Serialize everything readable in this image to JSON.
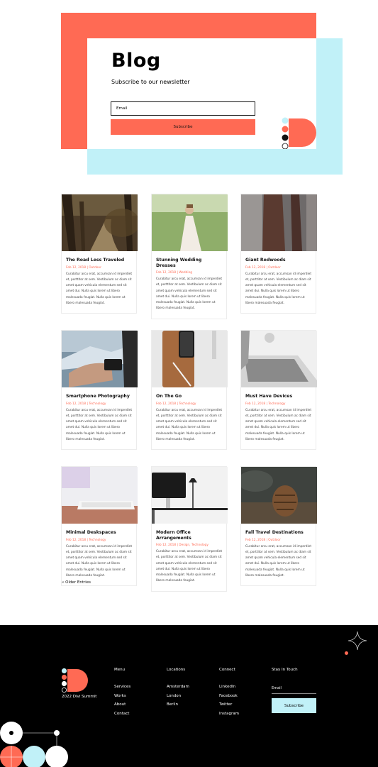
{
  "colors": {
    "coral": "#ff6a54",
    "cyan": "#c1f1f8",
    "black": "#000000"
  },
  "hero": {
    "title": "Blog",
    "subtitle": "Subscribe to our newsletter",
    "email_placeholder": "Email",
    "subscribe_label": "Subscribe"
  },
  "posts": [
    {
      "title": "The Road Less Traveled",
      "meta": "Feb 12, 2018 | Outdoor",
      "excerpt": "Curabitur arcu erat, accumsan id imperdiet et, porttitor at sem. Vestibulum ac diam sit amet quam vehicula elementum sed sit amet dui. Nulla quis lorem ut libero malesuada feugiat. Nulla quis lorem ut libero malesuada feugiat."
    },
    {
      "title": "Stunning Wedding Dresses",
      "meta": "Feb 12, 2018 | Wedding",
      "excerpt": "Curabitur arcu erat, accumsan id imperdiet et, porttitor at sem. Vestibulum ac diam sit amet quam vehicula elementum sed sit amet dui. Nulla quis lorem ut libero malesuada feugiat. Nulla quis lorem ut libero malesuada feugiat."
    },
    {
      "title": "Giant Redwoods",
      "meta": "Feb 12, 2018 | Outdoor",
      "excerpt": "Curabitur arcu erat, accumsan id imperdiet et, porttitor at sem. Vestibulum ac diam sit amet quam vehicula elementum sed sit amet dui. Nulla quis lorem ut libero malesuada feugiat. Nulla quis lorem ut libero malesuada feugiat."
    },
    {
      "title": "Smartphone Photography",
      "meta": "Feb 12, 2018 | Technology",
      "excerpt": "Curabitur arcu erat, accumsan id imperdiet et, porttitor at sem. Vestibulum ac diam sit amet quam vehicula elementum sed sit amet dui. Nulla quis lorem ut libero malesuada feugiat. Nulla quis lorem ut libero malesuada feugiat."
    },
    {
      "title": "On The Go",
      "meta": "Feb 12, 2018 | Technology",
      "excerpt": "Curabitur arcu erat, accumsan id imperdiet et, porttitor at sem. Vestibulum ac diam sit amet quam vehicula elementum sed sit amet dui. Nulla quis lorem ut libero malesuada feugiat. Nulla quis lorem ut libero malesuada feugiat."
    },
    {
      "title": "Must Have Devices",
      "meta": "Feb 12, 2018 | Technology",
      "excerpt": "Curabitur arcu erat, accumsan id imperdiet et, porttitor at sem. Vestibulum ac diam sit amet quam vehicula elementum sed sit amet dui. Nulla quis lorem ut libero malesuada feugiat. Nulla quis lorem ut libero malesuada feugiat."
    },
    {
      "title": "Minimal Deskspaces",
      "meta": "Feb 12, 2018 | Technology",
      "excerpt": "Curabitur arcu erat, accumsan id imperdiet et, porttitor at sem. Vestibulum ac diam sit amet quam vehicula elementum sed sit amet dui. Nulla quis lorem ut libero malesuada feugiat. Nulla quis lorem ut libero malesuada feugiat."
    },
    {
      "title": "Modern Office Arrangements",
      "meta": "Feb 12, 2018 | Design, Technology",
      "excerpt": "Curabitur arcu erat, accumsan id imperdiet et, porttitor at sem. Vestibulum ac diam sit amet quam vehicula elementum sed sit amet dui. Nulla quis lorem ut libero malesuada feugiat. Nulla quis lorem ut libero malesuada feugiat."
    },
    {
      "title": "Fall Travel Destinations",
      "meta": "Feb 12, 2018 | Outdoor",
      "excerpt": "Curabitur arcu erat, accumsan id imperdiet et, porttitor at sem. Vestibulum ac diam sit amet quam vehicula elementum sed sit amet dui. Nulla quis lorem ut libero malesuada feugiat. Nulla quis lorem ut libero malesuada feugiat."
    }
  ],
  "pagination": {
    "older_label": "« Older Entries"
  },
  "footer": {
    "copyright": "2022 Divi Summit",
    "menu": {
      "heading": "Menu",
      "links": [
        "Services",
        "Works",
        "About",
        "Contact"
      ]
    },
    "locations": {
      "heading": "Locations",
      "links": [
        "Amsterdam",
        "London",
        "Berlin"
      ]
    },
    "connect": {
      "heading": "Connect",
      "links": [
        "LinkedIn",
        "Facebook",
        "Twitter",
        "Instagram"
      ]
    },
    "stay": {
      "heading": "Stay In Touch",
      "email_label": "Email",
      "subscribe_label": "Subscribe"
    }
  }
}
